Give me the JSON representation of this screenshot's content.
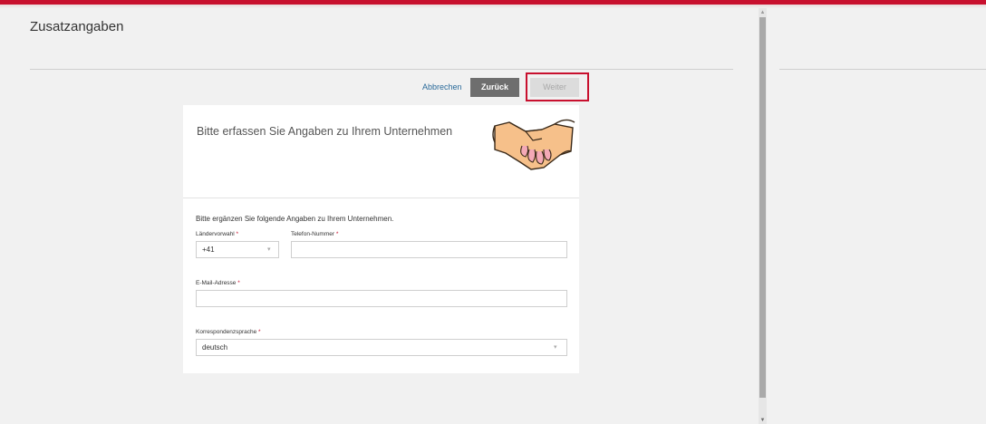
{
  "header": {
    "title": "Zusatzangaben"
  },
  "actions": {
    "cancel_label": "Abbrechen",
    "back_label": "Zurück",
    "next_label": "Weiter"
  },
  "card": {
    "heading": "Bitte erfassen Sie Angaben zu Ihrem Unternehmen",
    "intro": "Bitte ergänzen Sie folgende Angaben zu Ihrem Unternehmen.",
    "fields": {
      "country_code": {
        "label": "Ländervorwahl",
        "required_mark": "*",
        "value": "+41"
      },
      "phone": {
        "label": "Telefon-Nummer",
        "required_mark": "*",
        "value": ""
      },
      "email": {
        "label": "E-Mail-Adresse",
        "required_mark": "*",
        "value": ""
      },
      "language": {
        "label": "Korrespondenzsprache",
        "required_mark": "*",
        "value": "deutsch"
      }
    }
  },
  "icons": {
    "dropdown": "chevron-down-icon",
    "illustration": "handshake-icon"
  },
  "colors": {
    "accent": "#c8102e",
    "button_dark": "#6e6e6e",
    "button_disabled": "#dcdcdc",
    "link": "#2a6a9a"
  }
}
